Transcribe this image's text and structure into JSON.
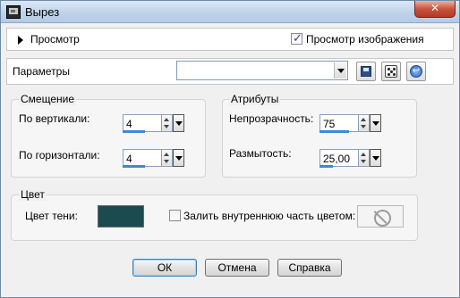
{
  "window": {
    "title": "Вырез",
    "close_glyph": "✕"
  },
  "preview": {
    "label": "Просмотр",
    "image_preview_label": "Просмотр изображения",
    "image_preview_checked": true
  },
  "params": {
    "label": "Параметры",
    "preset_value": ""
  },
  "offset": {
    "title": "Смещение",
    "vertical_label": "По вертикали:",
    "vertical_value": "4",
    "vertical_level": 0.57,
    "horizontal_label": "По горизонтали:",
    "horizontal_value": "4",
    "horizontal_level": 0.57
  },
  "attributes": {
    "title": "Атрибуты",
    "opacity_label": "Непрозрачность:",
    "opacity_value": "75",
    "opacity_level": 0.75,
    "blur_label": "Размытость:",
    "blur_value": "25,00",
    "blur_level": 0.35
  },
  "color": {
    "title": "Цвет",
    "shadow_color_label": "Цвет тени:",
    "shadow_color": "#1b4a4f",
    "fill_inner_label": "Залить внутреннюю часть цветом:",
    "fill_inner_checked": false
  },
  "buttons": {
    "ok": "ОК",
    "cancel": "Отмена",
    "help": "Справка"
  },
  "icons": [
    "app-icon",
    "expand-triangle-icon",
    "save-icon",
    "randomize-dice-icon",
    "reset-icon",
    "no-color-icon"
  ]
}
